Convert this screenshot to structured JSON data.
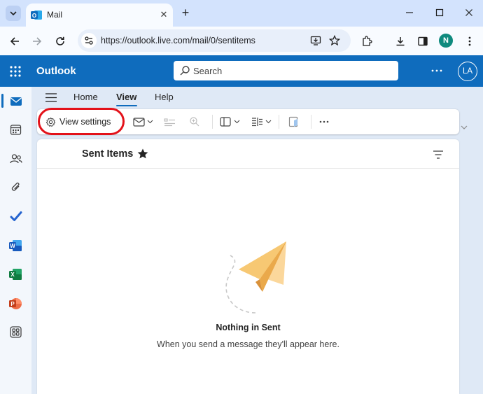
{
  "browser": {
    "tab": {
      "title": "Mail"
    },
    "url": "https://outlook.live.com/mail/0/sentitems",
    "profile_initial": "N"
  },
  "outlook": {
    "brand": "Outlook",
    "search": {
      "placeholder": "Search"
    },
    "user_initials": "LA",
    "ribbon_tabs": [
      "Home",
      "View",
      "Help"
    ],
    "active_tab": "View",
    "commands": {
      "view_settings": "View settings"
    },
    "folder": {
      "title": "Sent Items"
    },
    "empty_state": {
      "title": "Nothing in Sent",
      "subtitle": "When you send a message they'll appear here."
    }
  },
  "colors": {
    "accent": "#0f6cbd",
    "highlight_ring": "#e3121a",
    "paper_plane": "#f7c873"
  },
  "icons": {
    "rail": [
      "mail-icon",
      "calendar-icon",
      "people-icon",
      "attachment-icon",
      "todo-icon",
      "word-icon",
      "excel-icon",
      "powerpoint-icon",
      "apps-icon"
    ]
  }
}
